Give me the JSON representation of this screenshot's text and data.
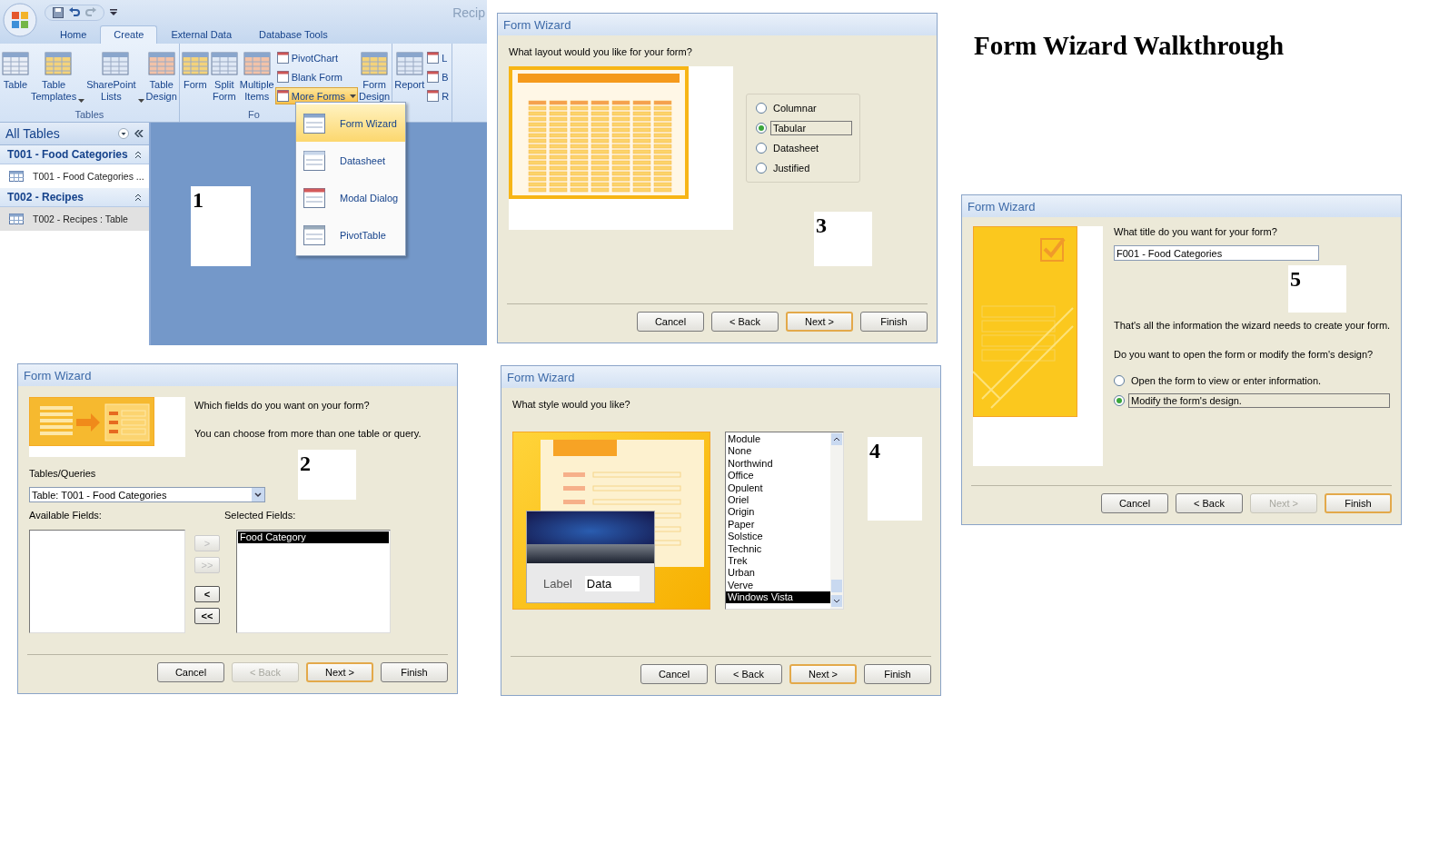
{
  "heading": "Form Wizard Walkthrough",
  "access_window": {
    "title": "Recip",
    "step_number": "1",
    "tabs": [
      {
        "label": "Home",
        "selected": false
      },
      {
        "label": "Create",
        "selected": true
      },
      {
        "label": "External Data",
        "selected": false
      },
      {
        "label": "Database Tools",
        "selected": false
      }
    ],
    "groups": [
      {
        "label": "Tables",
        "items": [
          {
            "kind": "large",
            "label": "Table",
            "dropdown": false
          },
          {
            "kind": "large",
            "label": "Table Templates",
            "dropdown": true
          },
          {
            "kind": "large",
            "label": "SharePoint Lists",
            "dropdown": true
          },
          {
            "kind": "large",
            "label": "Table Design",
            "dropdown": false
          }
        ]
      },
      {
        "label": "Fo",
        "items": [
          {
            "kind": "large",
            "label": "Form",
            "dropdown": false
          },
          {
            "kind": "large",
            "label": "Split Form",
            "dropdown": false
          },
          {
            "kind": "large",
            "label": "Multiple Items",
            "dropdown": false
          },
          {
            "kind": "stack",
            "buttons": [
              {
                "label": "PivotChart",
                "active": false,
                "dropdown": false
              },
              {
                "label": "Blank Form",
                "active": false,
                "dropdown": false
              },
              {
                "label": "More Forms",
                "active": true,
                "dropdown": true
              }
            ]
          },
          {
            "kind": "large",
            "label": "Form Design",
            "dropdown": false
          }
        ]
      },
      {
        "items": [
          {
            "kind": "large",
            "label": "Report",
            "dropdown": false
          },
          {
            "kind": "stack",
            "buttons": [
              {
                "label": "L",
                "active": false,
                "dropdown": false
              },
              {
                "label": "B",
                "active": false,
                "dropdown": false
              },
              {
                "label": "R",
                "active": false,
                "dropdown": false
              }
            ]
          }
        ]
      }
    ],
    "nav_pane": {
      "header": "All Tables",
      "groups": [
        {
          "label": "T001 - Food Categories",
          "expanded": true,
          "items": [
            {
              "label": "T001 - Food Categories ...",
              "selected": false
            }
          ]
        },
        {
          "label": "T002 - Recipes",
          "expanded": true,
          "items": [
            {
              "label": "T002 - Recipes : Table",
              "selected": true
            }
          ]
        }
      ]
    },
    "menu": [
      {
        "label": "Form Wizard",
        "selected": true
      },
      {
        "label": "Datasheet",
        "selected": false
      },
      {
        "label": "Modal Dialog",
        "selected": false
      },
      {
        "label": "PivotTable",
        "selected": false
      }
    ]
  },
  "wizards": [
    {
      "kind": "fields",
      "step_number": "2",
      "title": "Form Wizard",
      "question": "Which fields do you want on your form?",
      "note": "You can choose from more than one table or query.",
      "source_label": "Tables/Queries",
      "source_value": "Table: T001 - Food Categories",
      "available_label": "Available Fields:",
      "selected_label": "Selected Fields:",
      "selected_fields": [
        {
          "label": "Food Category",
          "selected": true
        }
      ],
      "move_buttons": [
        {
          "label": ">",
          "disabled": true
        },
        {
          "label": ">>",
          "disabled": true
        },
        {
          "label": "<",
          "disabled": false
        },
        {
          "label": "<<",
          "disabled": false
        }
      ],
      "buttons": [
        {
          "label": "Cancel",
          "disabled": false,
          "default": false
        },
        {
          "label": "< Back",
          "disabled": true,
          "default": false
        },
        {
          "label": "Next >",
          "disabled": false,
          "default": true
        },
        {
          "label": "Finish",
          "disabled": false,
          "default": false
        }
      ]
    },
    {
      "kind": "layout",
      "step_number": "3",
      "title": "Form Wizard",
      "question": "What layout would you like for your form?",
      "options": [
        {
          "label": "Columnar",
          "selected": false
        },
        {
          "label": "Tabular",
          "selected": true
        },
        {
          "label": "Datasheet",
          "selected": false
        },
        {
          "label": "Justified",
          "selected": false
        }
      ],
      "buttons": [
        {
          "label": "Cancel",
          "disabled": false,
          "default": false
        },
        {
          "label": "< Back",
          "disabled": false,
          "default": false
        },
        {
          "label": "Next >",
          "disabled": false,
          "default": true
        },
        {
          "label": "Finish",
          "disabled": false,
          "default": false
        }
      ]
    },
    {
      "kind": "style",
      "step_number": "4",
      "title": "Form Wizard",
      "question": "What style would you like?",
      "preview_label": "Label",
      "preview_data": "Data",
      "styles": [
        {
          "label": "Module",
          "selected": false
        },
        {
          "label": "None",
          "selected": false
        },
        {
          "label": "Northwind",
          "selected": false
        },
        {
          "label": "Office",
          "selected": false
        },
        {
          "label": "Opulent",
          "selected": false
        },
        {
          "label": "Oriel",
          "selected": false
        },
        {
          "label": "Origin",
          "selected": false
        },
        {
          "label": "Paper",
          "selected": false
        },
        {
          "label": "Solstice",
          "selected": false
        },
        {
          "label": "Technic",
          "selected": false
        },
        {
          "label": "Trek",
          "selected": false
        },
        {
          "label": "Urban",
          "selected": false
        },
        {
          "label": "Verve",
          "selected": false
        },
        {
          "label": "Windows Vista",
          "selected": true
        }
      ],
      "buttons": [
        {
          "label": "Cancel",
          "disabled": false,
          "default": false
        },
        {
          "label": "< Back",
          "disabled": false,
          "default": false
        },
        {
          "label": "Next >",
          "disabled": false,
          "default": true
        },
        {
          "label": "Finish",
          "disabled": false,
          "default": false
        }
      ]
    },
    {
      "kind": "title",
      "step_number": "5",
      "title": "Form Wizard",
      "question": "What title do you want for your form?",
      "form_title": "F001 - Food Categories",
      "info": "That's all the information the wizard needs to create your form.",
      "prompt": "Do you want to open the form or modify the form's design?",
      "options": [
        {
          "label": "Open the form to view or enter information.",
          "selected": false
        },
        {
          "label": "Modify the form's design.",
          "selected": true
        }
      ],
      "buttons": [
        {
          "label": "Cancel",
          "disabled": false,
          "default": false
        },
        {
          "label": "< Back",
          "disabled": false,
          "default": false
        },
        {
          "label": "Next >",
          "disabled": true,
          "default": false
        },
        {
          "label": "Finish",
          "disabled": false,
          "default": true
        }
      ]
    }
  ]
}
